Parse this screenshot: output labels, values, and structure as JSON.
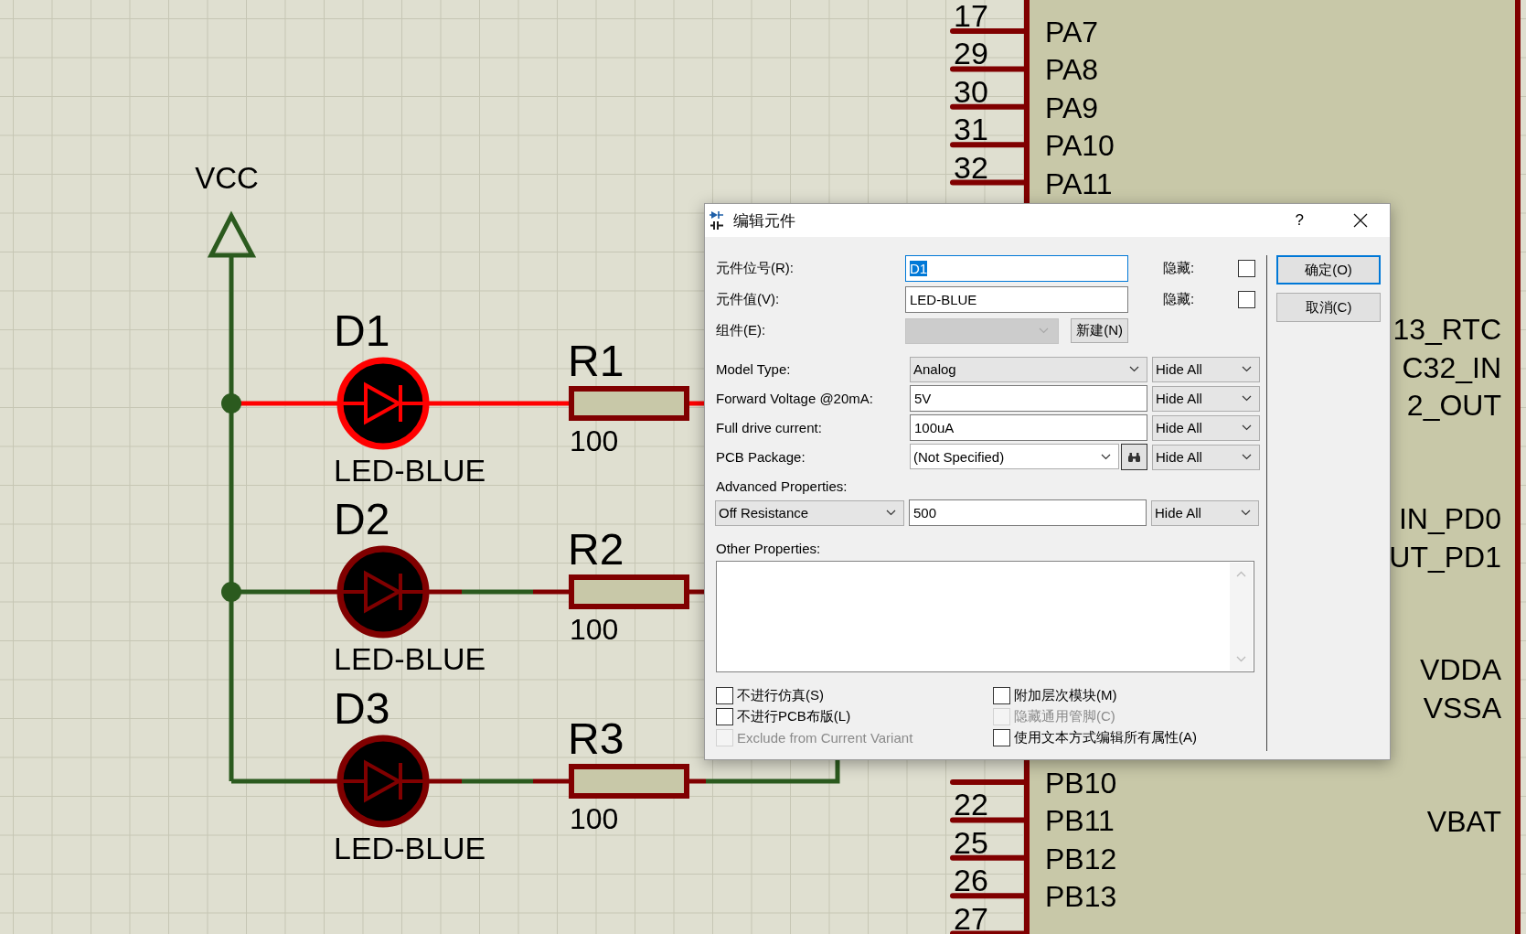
{
  "schematic": {
    "power": {
      "label": "VCC"
    },
    "branches": [
      {
        "led": {
          "ref": "D1",
          "value": "LED-BLUE",
          "selected": true
        },
        "resistor": {
          "ref": "R1",
          "value": "100"
        }
      },
      {
        "led": {
          "ref": "D2",
          "value": "LED-BLUE",
          "selected": false
        },
        "resistor": {
          "ref": "R2",
          "value": "100"
        }
      },
      {
        "led": {
          "ref": "D3",
          "value": "LED-BLUE",
          "selected": false
        },
        "resistor": {
          "ref": "R3",
          "value": "100"
        }
      }
    ],
    "chip": {
      "left_pins_top": [
        {
          "number": "17",
          "name": "PA7"
        },
        {
          "number": "29",
          "name": "PA8"
        },
        {
          "number": "30",
          "name": "PA9"
        },
        {
          "number": "31",
          "name": "PA10"
        },
        {
          "number": "32",
          "name": "PA11"
        }
      ],
      "left_pins_bottom": [
        {
          "name": "PB10"
        },
        {
          "number": "22",
          "name": "PB11"
        },
        {
          "number": "25",
          "name": "PB12"
        },
        {
          "number": "26",
          "name": "PB13"
        },
        {
          "number": "27"
        }
      ],
      "right_labels": [
        "13_RTC",
        "C32_IN",
        "2_OUT",
        "IN_PD0",
        "UT_PD1",
        "VDDA",
        "VSSA",
        "VBAT"
      ]
    }
  },
  "dialog": {
    "title": "编辑元件",
    "help": "?",
    "fields": [
      {
        "label": "元件位号(R):",
        "value": "D1",
        "text_selected": true,
        "hide_label": "隐藏:",
        "hidden": false
      },
      {
        "label": "元件值(V):",
        "value": "LED-BLUE",
        "text_selected": false,
        "hide_label": "隐藏:",
        "hidden": false
      }
    ],
    "part": {
      "label": "组件(E):",
      "disabled": true,
      "new_button": "新建(N)"
    },
    "properties": [
      {
        "kind": "dropdown",
        "label": "Model Type:",
        "value": "Analog",
        "visibility": "Hide All"
      },
      {
        "kind": "text",
        "label": "Forward Voltage @20mA:",
        "value": "5V",
        "visibility": "Hide All"
      },
      {
        "kind": "text",
        "label": "Full drive current:",
        "value": "100uA",
        "visibility": "Hide All"
      },
      {
        "kind": "package",
        "label": "PCB Package:",
        "value": "(Not Specified)",
        "visibility": "Hide All"
      }
    ],
    "advanced": {
      "label": "Advanced Properties:",
      "property": "Off Resistance",
      "value": "500",
      "visibility": "Hide All"
    },
    "other": {
      "label": "Other Properties:"
    },
    "options": [
      {
        "label": "不进行仿真(S)",
        "checked": false,
        "disabled": false
      },
      {
        "label": "不进行PCB布版(L)",
        "checked": false,
        "disabled": false
      },
      {
        "label": "Exclude from Current Variant",
        "checked": false,
        "disabled": true
      },
      {
        "label": "附加层次模块(M)",
        "checked": false,
        "disabled": false
      },
      {
        "label": "隐藏通用管脚(C)",
        "checked": false,
        "disabled": true
      },
      {
        "label": "使用文本方式编辑所有属性(A)",
        "checked": false,
        "disabled": false
      }
    ],
    "buttons": [
      {
        "label": "确定(O)",
        "default": true
      },
      {
        "label": "取消(C)",
        "default": false
      }
    ]
  }
}
